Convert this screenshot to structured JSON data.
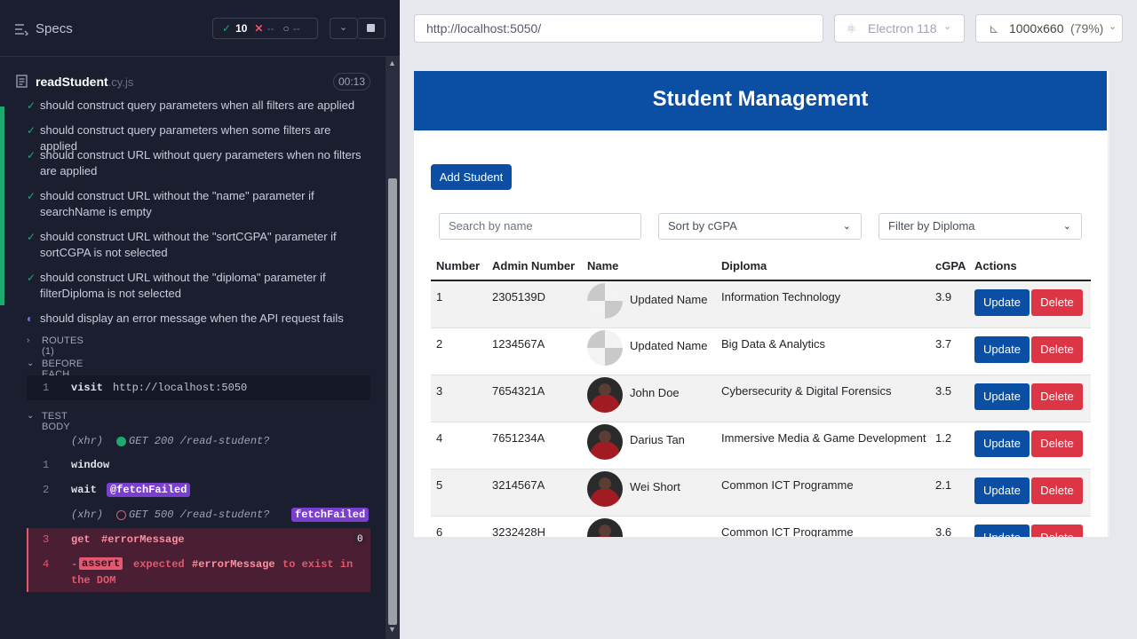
{
  "reporter": {
    "specs_label": "Specs",
    "stats": {
      "passed": "10",
      "failed": "--",
      "pending": "--"
    },
    "file": {
      "name": "readStudent",
      "ext": ".cy.js",
      "timer": "00:13"
    },
    "tests": [
      {
        "text": "should construct query parameters when all filters are applied",
        "state": "passed"
      },
      {
        "text": "should construct query parameters when some filters are applied",
        "state": "passed"
      },
      {
        "text": "should construct URL without query parameters when no filters are applied",
        "state": "passed"
      },
      {
        "text": "should construct URL without the \"name\" parameter if searchName is empty",
        "state": "passed"
      },
      {
        "text": "should construct URL without the \"sortCGPA\" parameter if sortCGPA is not selected",
        "state": "passed"
      },
      {
        "text": "should construct URL without the \"diploma\" parameter if filterDiploma is not selected",
        "state": "passed"
      },
      {
        "text": "should display an error message when the API request fails",
        "state": "running"
      }
    ],
    "routes_label": "ROUTES (1)",
    "before_each_label": "BEFORE EACH",
    "test_body_label": "TEST BODY",
    "commands": {
      "visit_num": "1",
      "visit_name": "visit",
      "visit_arg": "http://localhost:5050",
      "xhr1_type": "(xhr)",
      "xhr1_text": "GET 200 /read-student?",
      "window_num": "1",
      "window_name": "window",
      "wait_num": "2",
      "wait_name": "wait",
      "wait_alias": "@fetchFailed",
      "xhr2_type": "(xhr)",
      "xhr2_text": "GET 500 /read-student?",
      "xhr2_alias": "fetchFailed",
      "get_num": "3",
      "get_name": "get",
      "get_arg": "#errorMessage",
      "get_count": "0",
      "assert_num": "4",
      "assert_name": "assert",
      "assert_text1": "expected",
      "assert_sel": "#errorMessage",
      "assert_text2": "to exist in",
      "assert_text3": "the DOM"
    }
  },
  "runner": {
    "url": "http://localhost:5050/",
    "browser": "Electron 118",
    "viewport": "1000x660",
    "zoom": "(79%)"
  },
  "app": {
    "title": "Student Management",
    "add_button": "Add Student",
    "search_placeholder": "Search by name",
    "sort_value": "Sort by cGPA",
    "filter_value": "Filter by Diploma",
    "columns": [
      "Number",
      "Admin Number",
      "Name",
      "Diploma",
      "cGPA",
      "Actions"
    ],
    "update_label": "Update",
    "delete_label": "Delete",
    "rows": [
      {
        "number": "1",
        "admin": "2305139D",
        "name": "Updated Name",
        "diploma": "Information Technology",
        "cgpa": "3.9",
        "avatar": "default"
      },
      {
        "number": "2",
        "admin": "1234567A",
        "name": "Updated Name",
        "diploma": "Big Data & Analytics",
        "cgpa": "3.7",
        "avatar": "default"
      },
      {
        "number": "3",
        "admin": "7654321A",
        "name": "John Doe",
        "diploma": "Cybersecurity & Digital Forensics",
        "cgpa": "3.5",
        "avatar": "photo"
      },
      {
        "number": "4",
        "admin": "7651234A",
        "name": "Darius Tan",
        "diploma": "Immersive Media & Game Development",
        "cgpa": "1.2",
        "avatar": "photo"
      },
      {
        "number": "5",
        "admin": "3214567A",
        "name": "Wei Short",
        "diploma": "Common ICT Programme",
        "cgpa": "2.1",
        "avatar": "photo"
      },
      {
        "number": "6",
        "admin": "3232428H",
        "name": "",
        "diploma": "Common ICT Programme",
        "cgpa": "3.6",
        "avatar": "photo"
      }
    ]
  }
}
